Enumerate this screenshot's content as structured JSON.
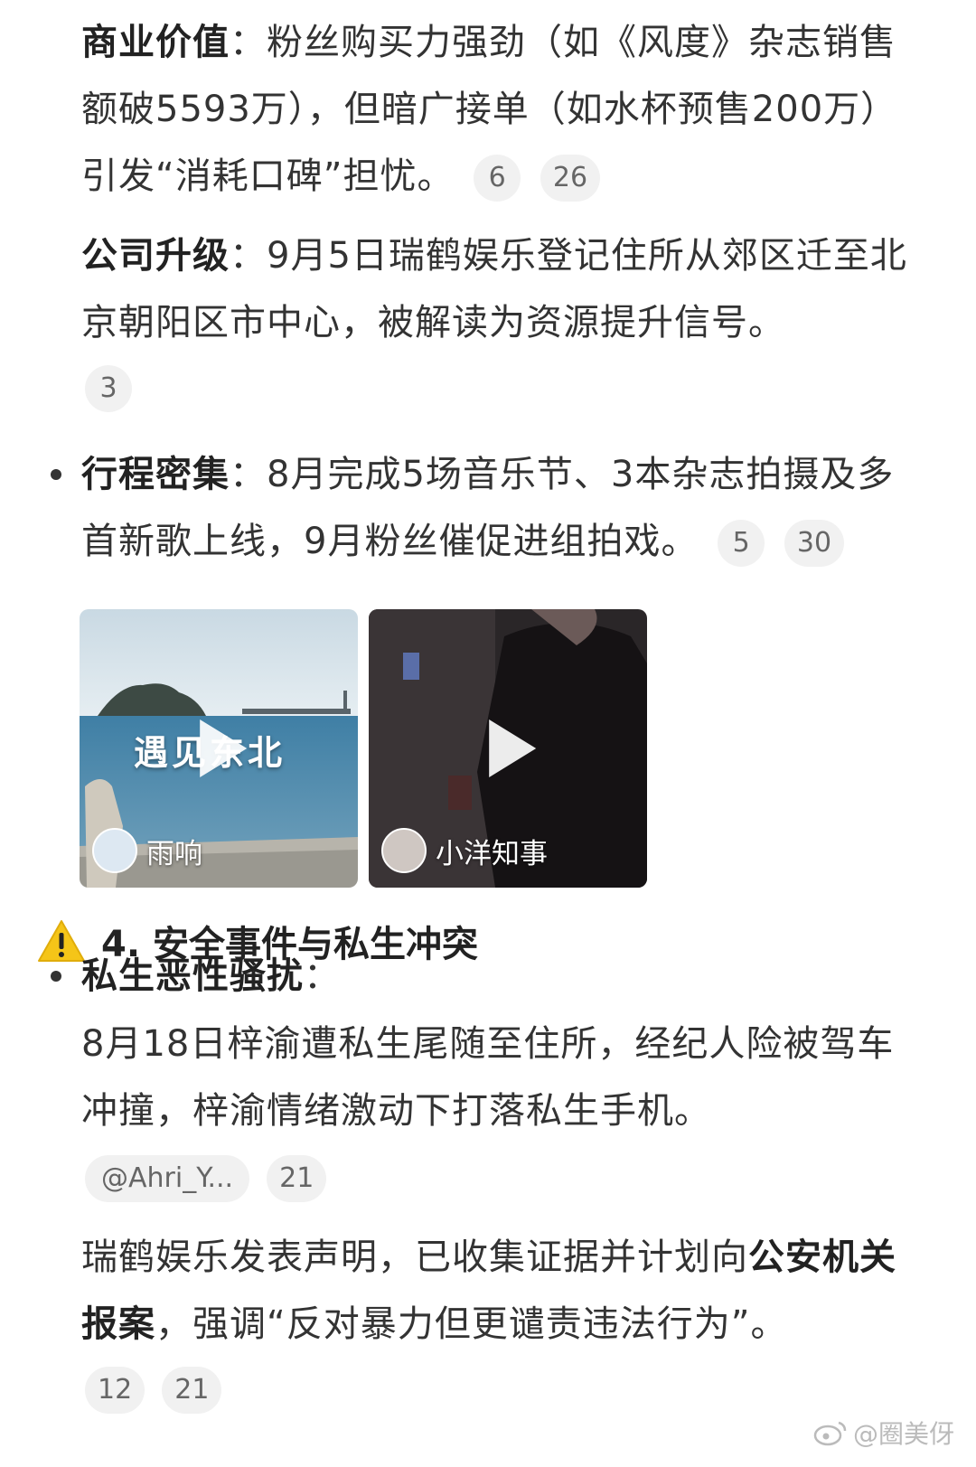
{
  "section_business": {
    "label": "商业价值",
    "sep": "：",
    "text": "粉丝购买力强劲（如《风度》杂志销售额破5593万），但暗广接单（如水杯预售200万）引发“消耗口碑”担忧。",
    "refs": [
      "6",
      "26"
    ]
  },
  "section_company": {
    "label": "公司升级",
    "sep": "：",
    "text": "9月5日瑞鹤娱乐登记住所从郊区迁至北京朝阳区市中心，被解读为资源提升信号。",
    "refs": [
      "3"
    ]
  },
  "section_schedule": {
    "label": "行程密集",
    "sep": "：",
    "text": "8月完成5场音乐节、3本杂志拍摄及多首新歌上线，9月粉丝催促进组拍戏。",
    "refs": [
      "5",
      "30"
    ]
  },
  "video_cards": [
    {
      "author": "雨响",
      "overlay_text": "遇见东北"
    },
    {
      "author": "小洋知事"
    }
  ],
  "section4": {
    "warning_icon": "⚠",
    "title": "4. 安全事件与私生冲突"
  },
  "section_harass": {
    "label": "私生恶性骚扰",
    "sep": "：",
    "text": "8月18日梓渝遭私生尾随至住所，经纪人险被驾车冲撞，梓渝情绪激动下打落私生手机。",
    "refs": [
      "@Ahri_Y...",
      "21"
    ]
  },
  "section_statement": {
    "text_a": "瑞鹤娱乐发表声明，已收集证据并计划向",
    "bold": "公安机关报案",
    "text_b": "，强调“反对暴力但更谴责违法行为”。",
    "refs": [
      "12",
      "21"
    ]
  },
  "watermark": {
    "text": "@圈美伢",
    "icon": "weibo-icon"
  },
  "colors": {
    "text": "#333333",
    "ref_bg": "#f1f1f1",
    "warning": "#f5c518"
  }
}
